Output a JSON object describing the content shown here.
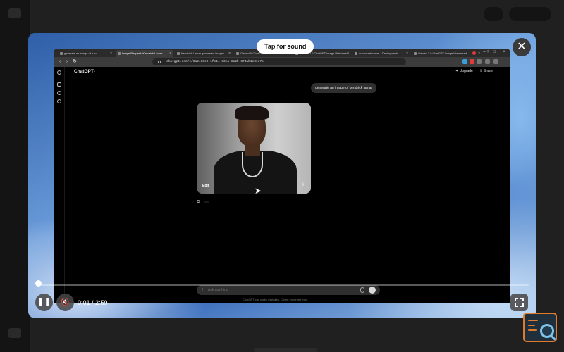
{
  "overlay": {
    "tap_for_sound": "Tap for sound",
    "close_glyph": "✕"
  },
  "browser": {
    "tabs": [
      {
        "label": "generate an image of a so..."
      },
      {
        "label": "Image Request: Kendrick Lamar"
      },
      {
        "label": "Kendrick Lamar generated images"
      },
      {
        "label": "Gemini & ChatGPT"
      },
      {
        "label": "Gemini 2.0 ChatGPT Image Watermark"
      },
      {
        "label": "quickstartmarket - Deployments"
      },
      {
        "label": "Gemini 2.0 ChatGPT Image Watermark"
      }
    ],
    "new_tab_glyph": "+",
    "url": "chatgpt.com/c/6a2480c0-1fc14-83ea-8a2b-374ab1c31e7a",
    "nav": {
      "back": "‹",
      "forward": "›",
      "reload": "↻"
    }
  },
  "chatgpt": {
    "model": "ChatGPT",
    "model_chevron": "⌄",
    "upgrade": "✦ Upgrade",
    "share": "⇧ Share",
    "more": "⋯",
    "user_message": "generate an image of kendrick lamar",
    "image_edit": "Edit",
    "image_download": "⇩",
    "actions": {
      "copy": "⧉",
      "more": "⋯"
    },
    "composer_placeholder": "Ask anything",
    "composer_plus": "+",
    "disclaimer": "ChatGPT can make mistakes. Check important info."
  },
  "player": {
    "current_time": "0:01",
    "duration": "2:59",
    "time_text": "0:01 / 2:59",
    "progress_fraction": 0.006,
    "play_state": "playing",
    "muted": true,
    "pause_glyph": "❚❚",
    "mute_glyph": "🔇"
  },
  "colors": {
    "accent_orange": "#e07b2c",
    "widget_blue": "#7fc4e8"
  }
}
